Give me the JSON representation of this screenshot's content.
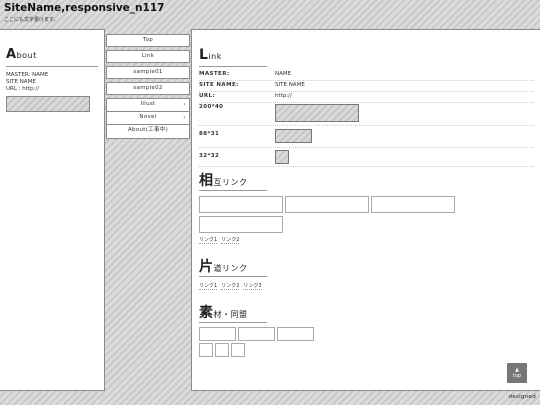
{
  "header": {
    "site_title": "SiteName,responsive_n117",
    "subtitle": "ここにも文字書けます。"
  },
  "about": {
    "initial": "A",
    "rest": "bout",
    "master": "MASTER: NAME",
    "site_name": "SITE NAME",
    "url": "URL : http://"
  },
  "nav": {
    "top": "Top",
    "link": "Link",
    "sample01": "sample01",
    "sample02": "sample02",
    "illust": "Illust",
    "novel": "Novel",
    "about": "About(工事中)",
    "arrow": "›"
  },
  "link_section": {
    "initial": "L",
    "rest": "ink",
    "rows": [
      {
        "key": "MASTER:",
        "value": "NAME"
      },
      {
        "key": "SITE NAME:",
        "value": "SITE NAME"
      },
      {
        "key": "URL:",
        "value": "http://"
      },
      {
        "key": "200*40",
        "value": ""
      },
      {
        "key": "88*31",
        "value": ""
      },
      {
        "key": "32*32",
        "value": ""
      }
    ]
  },
  "mutual": {
    "initial": "相",
    "rest": "互リンク",
    "links": [
      "リンク1",
      "リンク2"
    ]
  },
  "oneway": {
    "initial": "片",
    "rest": "道リンク",
    "links": [
      "リンク1",
      "リンク2",
      "リンク3"
    ]
  },
  "sozai": {
    "initial": "素",
    "rest": "材・同盟"
  },
  "top_button": {
    "label": "top",
    "arrow": "▲"
  },
  "footer": {
    "credit": "designed"
  }
}
